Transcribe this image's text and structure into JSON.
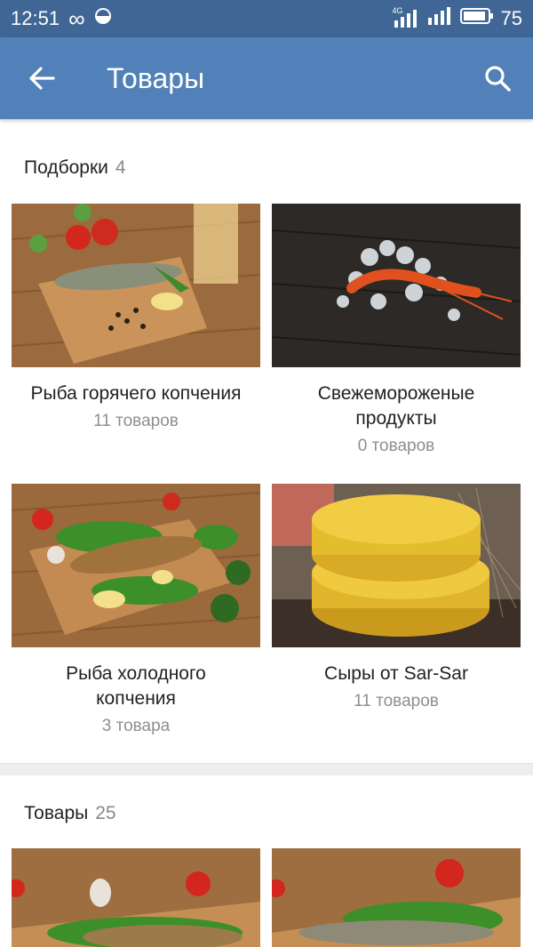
{
  "status": {
    "time": "12:51",
    "network": "4G",
    "battery": "75"
  },
  "appbar": {
    "title": "Товары"
  },
  "collections": {
    "label": "Подборки",
    "count": "4",
    "items": [
      {
        "name": "Рыба горячего копчения",
        "sub": "11 товаров"
      },
      {
        "name": "Свежемороженые продукты",
        "sub": "0 товаров"
      },
      {
        "name": "Рыба холодного копчения",
        "sub": "3 товара"
      },
      {
        "name": "Сыры от Sar-Sar",
        "sub": "11 товаров"
      }
    ]
  },
  "products": {
    "label": "Товары",
    "count": "25"
  },
  "colors": {
    "statusbar": "#3f6694",
    "appbar": "#5181b8",
    "text": "#222222",
    "muted": "#8e8e8e"
  }
}
